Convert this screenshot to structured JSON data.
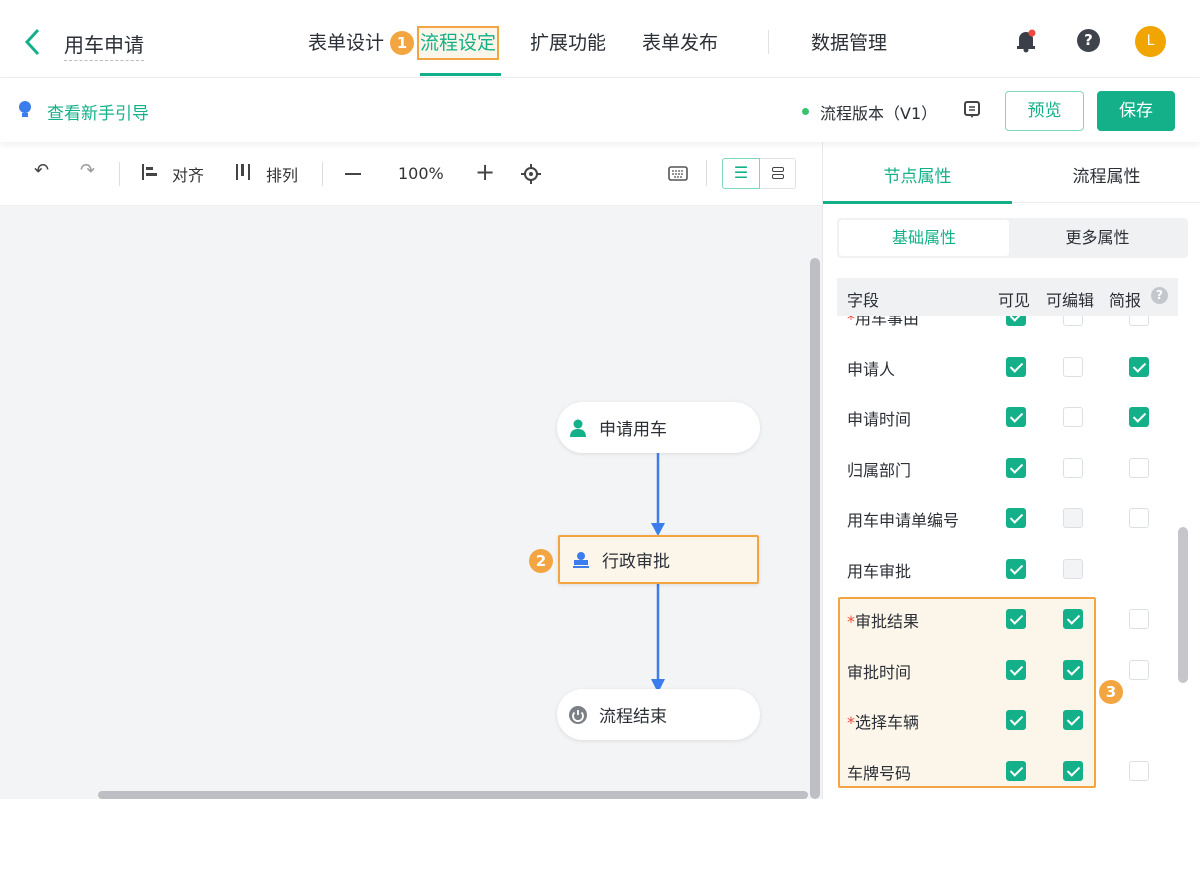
{
  "header": {
    "title": "用车申请",
    "tabs": [
      {
        "label": "表单设计"
      },
      {
        "label": "流程设定",
        "active": true
      },
      {
        "label": "扩展功能"
      },
      {
        "label": "表单发布"
      },
      {
        "label": "数据管理"
      }
    ],
    "avatar": "L",
    "badges": [
      "1",
      "2",
      "3"
    ]
  },
  "subheader": {
    "guide": "查看新手引导",
    "version": "流程版本（V1）",
    "preview": "预览",
    "save": "保存"
  },
  "toolbar": {
    "align": "对齐",
    "arrange": "排列",
    "zoom": "100%"
  },
  "flow": {
    "nodes": [
      {
        "label": "申请用车"
      },
      {
        "label": "行政审批"
      },
      {
        "label": "流程结束"
      }
    ]
  },
  "panel": {
    "tabs": [
      "节点属性",
      "流程属性"
    ],
    "segments": [
      "基础属性",
      "更多属性"
    ],
    "columns": [
      "字段",
      "可见",
      "可编辑",
      "简报"
    ],
    "rows": [
      {
        "label": "用车事由",
        "required": true,
        "visible": true,
        "editable": false,
        "brief": false
      },
      {
        "label": "申请人",
        "required": false,
        "visible": true,
        "editable": false,
        "brief": true
      },
      {
        "label": "申请时间",
        "required": false,
        "visible": true,
        "editable": false,
        "brief": true
      },
      {
        "label": "归属部门",
        "required": false,
        "visible": true,
        "editable": false,
        "brief": false
      },
      {
        "label": "用车申请单编号",
        "required": false,
        "visible": true,
        "editable": "disabled",
        "brief": false
      },
      {
        "label": "用车审批",
        "required": false,
        "visible": true,
        "editable": "disabled",
        "brief": null
      },
      {
        "label": "审批结果",
        "required": true,
        "visible": true,
        "editable": true,
        "brief": false
      },
      {
        "label": "审批时间",
        "required": false,
        "visible": true,
        "editable": true,
        "brief": false
      },
      {
        "label": "选择车辆",
        "required": true,
        "visible": true,
        "editable": true,
        "brief": null
      },
      {
        "label": "车牌号码",
        "required": false,
        "visible": true,
        "editable": true,
        "brief": false
      }
    ]
  },
  "colors": {
    "accent": "#14b08a",
    "highlight": "#f2a540",
    "arrow": "#3b7ded"
  }
}
